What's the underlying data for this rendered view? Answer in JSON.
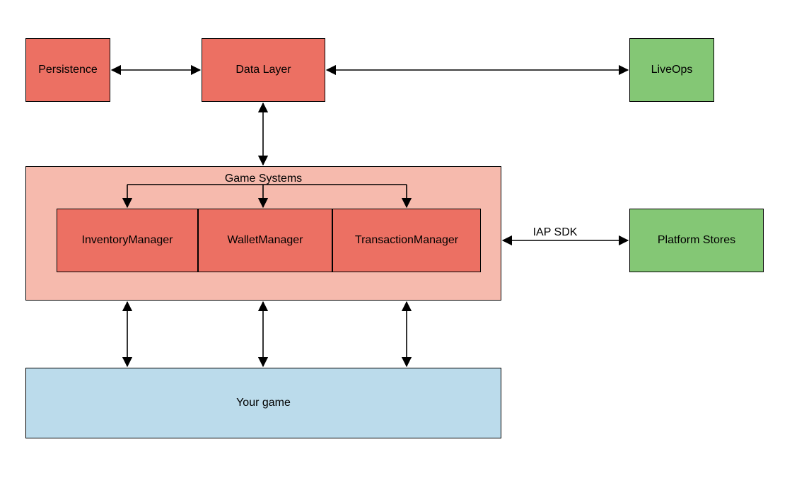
{
  "nodes": {
    "persistence": "Persistence",
    "data_layer": "Data Layer",
    "liveops": "LiveOps",
    "game_systems": "Game Systems",
    "inventory": "InventoryManager",
    "wallet": "WalletManager",
    "transaction": "TransactionManager",
    "platform_stores": "Platform Stores",
    "your_game": "Your game"
  },
  "edges": {
    "iap_sdk": "IAP SDK"
  },
  "colors": {
    "red": "#ec7063",
    "pink": "#f6baad",
    "green": "#84c775",
    "blue": "#bbdbeb"
  }
}
